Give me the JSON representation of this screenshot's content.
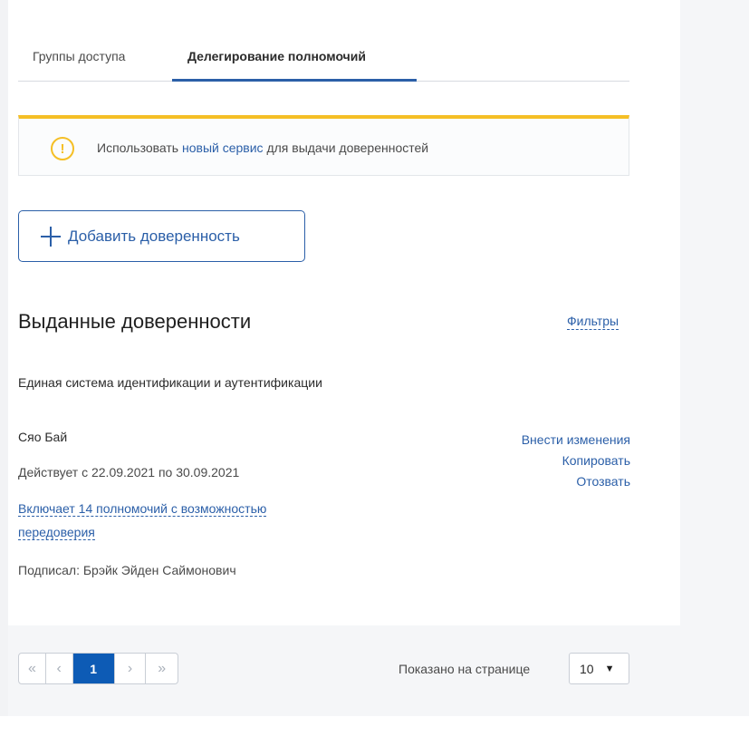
{
  "tabs": [
    {
      "label": "Группы доступа"
    },
    {
      "label": "Делегирование полномочий"
    }
  ],
  "alert": {
    "icon": "warning-icon",
    "text_before": "Использовать ",
    "link": "новый сервис",
    "text_after": " для выдачи доверенностей"
  },
  "add_button": {
    "label": "Добавить доверенность",
    "icon": "plus-icon"
  },
  "section": {
    "title": "Выданные доверенности",
    "filters_label": "Фильтры"
  },
  "system_name": "Единая система идентификации и аутентификации",
  "record": {
    "name": "Сяо Бай",
    "validity": "Действует с 22.09.2021 по 30.09.2021",
    "permissions_line1": "Включает 14 полномочий с возможностью",
    "permissions_line2": "передоверия",
    "signed_by": "Подписал: Брэйк Эйден Саймонович",
    "actions": [
      "Внести изменения",
      "Копировать",
      "Отозвать"
    ]
  },
  "pagination": {
    "first": "«",
    "prev": "‹",
    "current": "1",
    "next": "›",
    "last": "»",
    "per_page_label": "Показано на странице",
    "per_page_value": "10",
    "caret": "▼"
  },
  "colors": {
    "accent": "#2b5fa8",
    "warning": "#f5bf25",
    "active_page": "#0d5bb5"
  }
}
